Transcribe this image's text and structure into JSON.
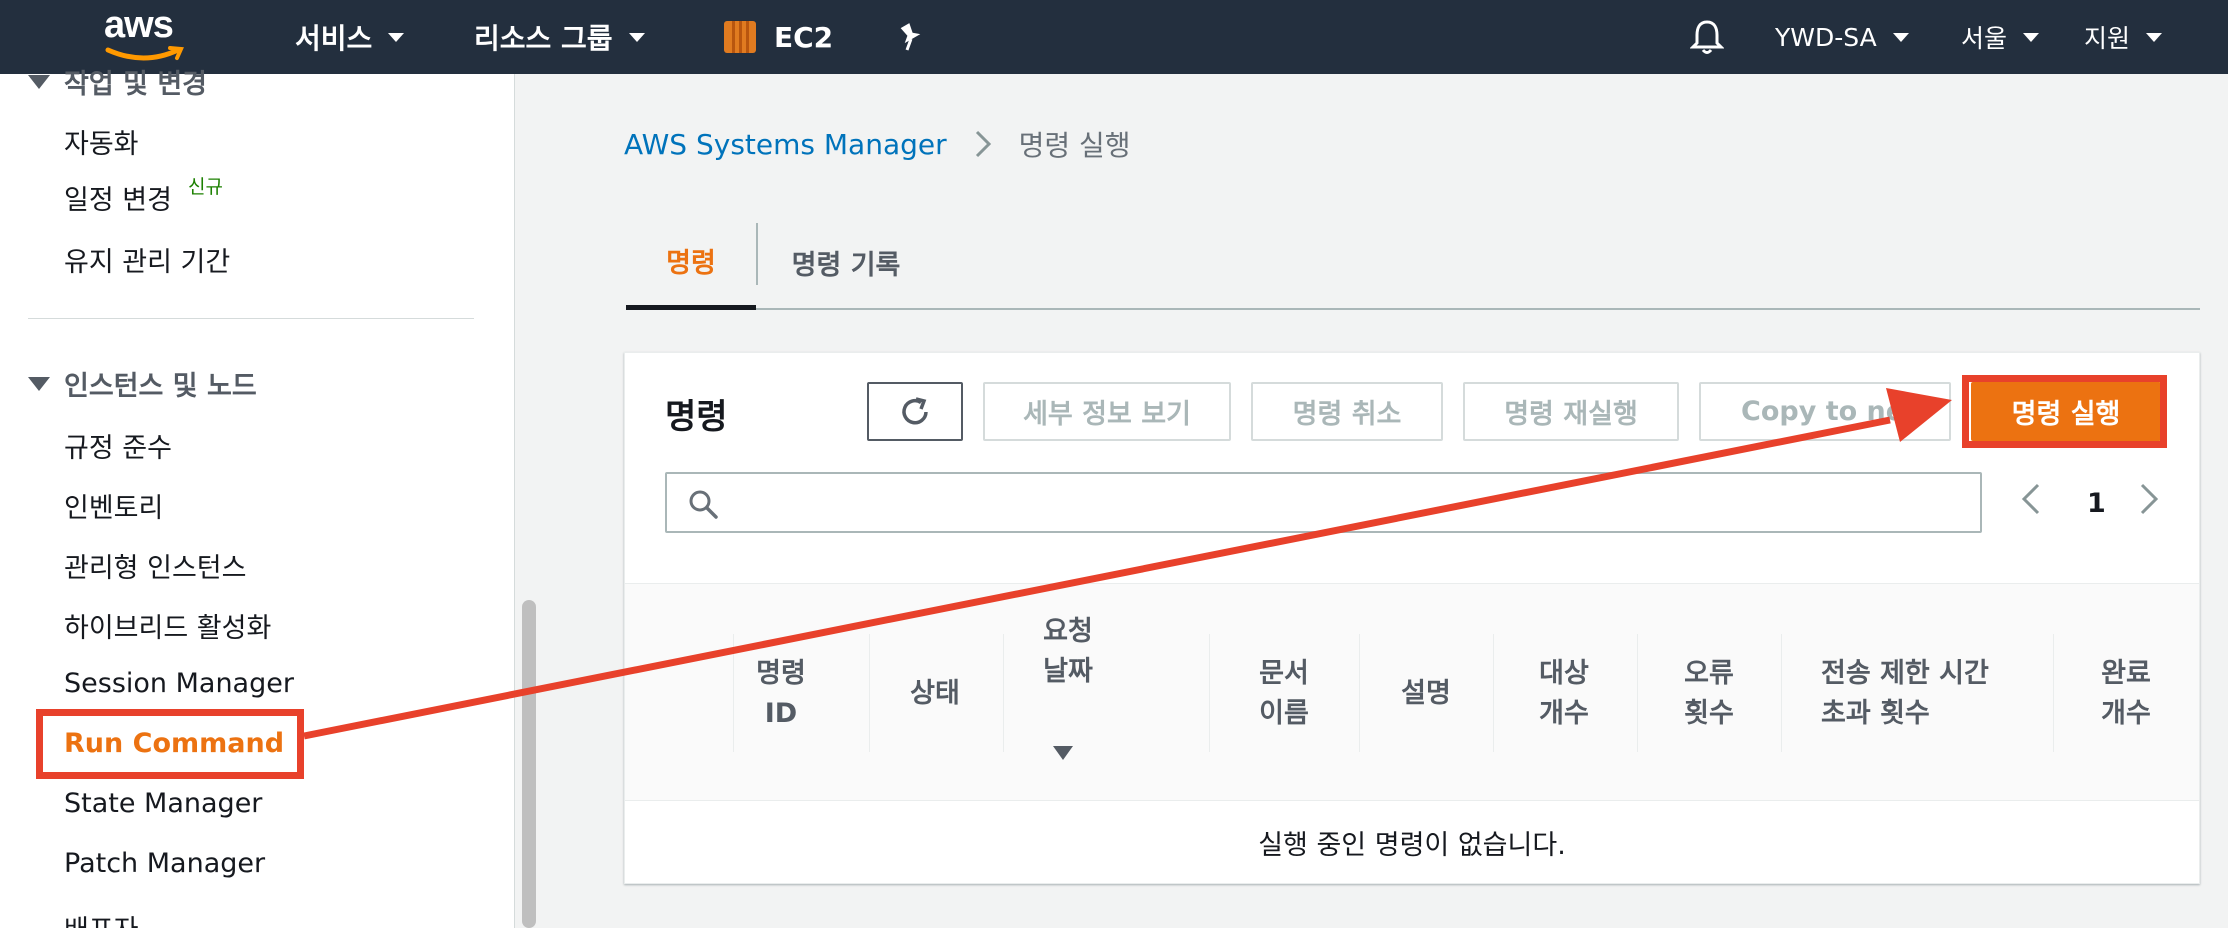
{
  "topnav": {
    "logo": "aws",
    "services": "서비스",
    "resource_groups": "리소스 그룹",
    "ec2": "EC2",
    "account": "YWD-SA",
    "region": "서울",
    "support": "지원"
  },
  "sidebar": {
    "partial_top": "작업 및 변경",
    "items_top": [
      "자동화",
      "일정 변경",
      "유지 관리 기간"
    ],
    "new_badge": "신규",
    "section": "인스턴스 및 노드",
    "items": [
      "규정 준수",
      "인벤토리",
      "관리형 인스턴스",
      "하이브리드 활성화",
      "Session Manager",
      "Run Command",
      "State Manager",
      "Patch Manager",
      "배포자"
    ],
    "active_item": "Run Command"
  },
  "breadcrumb": {
    "parent": "AWS Systems Manager",
    "current": "명령 실행"
  },
  "tabs": [
    "명령",
    "명령 기록"
  ],
  "panel": {
    "title": "명령",
    "buttons": {
      "details": "세부 정보 보기",
      "cancel": "명령 취소",
      "rerun": "명령 재실행",
      "copy": "Copy to new",
      "run": "명령 실행"
    },
    "search_placeholder": "",
    "page": "1"
  },
  "table": {
    "columns": [
      [
        "명령",
        "ID"
      ],
      [
        "상태"
      ],
      [
        "요청",
        "날짜"
      ],
      [
        "문서",
        "이름"
      ],
      [
        "설명"
      ],
      [
        "대상",
        "개수"
      ],
      [
        "오류",
        "횟수"
      ],
      [
        "전송 제한 시간",
        "초과 횟수"
      ],
      [
        "완료",
        "개수"
      ]
    ],
    "sort_column": "요청 날짜",
    "empty_message": "실행 중인 명령이 없습니다."
  },
  "colors": {
    "nav_bg": "#232f3e",
    "accent": "#ec7211",
    "link": "#0073bb",
    "annotation": "#e8412b"
  }
}
